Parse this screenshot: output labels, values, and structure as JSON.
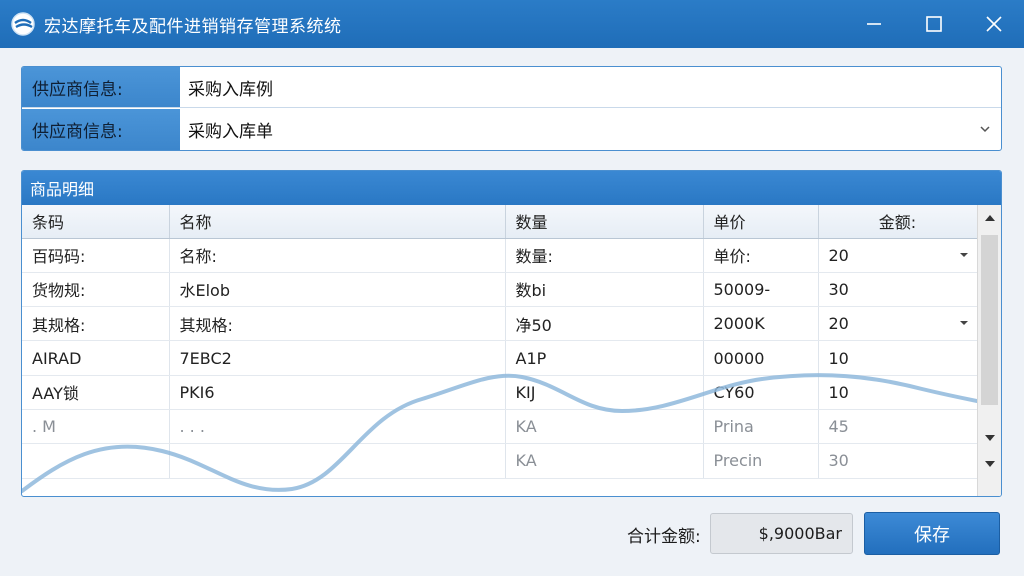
{
  "window": {
    "title": "宏达摩托车及配件进销销存管理系统统"
  },
  "supplier": {
    "rows": [
      {
        "label": "供应商信息:",
        "value": "采购入库例"
      },
      {
        "label": "供应商信息:",
        "value": "采购入库单"
      }
    ]
  },
  "grid": {
    "title": "商品明细",
    "columns": [
      "条码",
      "名称",
      "数量",
      "单价",
      "金额:"
    ],
    "rows": [
      [
        "百码码:",
        "名称:",
        "数量:",
        "单价:",
        "20"
      ],
      [
        "货物规:",
        "水Elob",
        "数bi",
        "50009-",
        "30"
      ],
      [
        "其规格:",
        "其规格:",
        "净50",
        "2000K",
        "20"
      ],
      [
        "AIRAD",
        "7EBC2",
        "A1P",
        "00000",
        "10"
      ],
      [
        "AAY锁",
        "PKI6",
        "KIJ",
        "CY60",
        "10"
      ],
      [
        ".   M",
        ".   .   .",
        "KA",
        "Prina",
        "45"
      ],
      [
        "",
        "",
        "KA",
        "Precin",
        "30"
      ]
    ]
  },
  "footer": {
    "total_label": "合计金额:",
    "total_value": "$,9000Bar",
    "save_label": "保存"
  },
  "colors": {
    "titlebar": "#1f6db8",
    "accent": "#3c86cc",
    "curve": "#8fb8dc"
  }
}
